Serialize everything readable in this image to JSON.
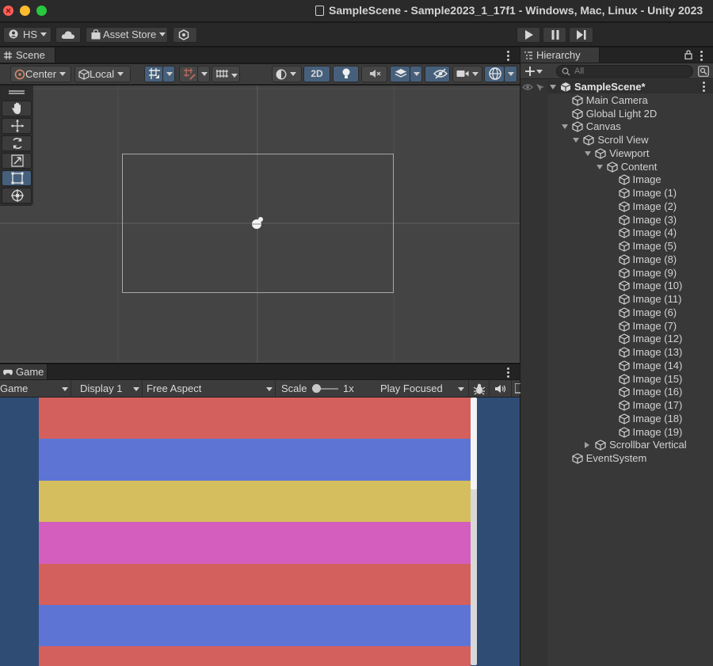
{
  "window": {
    "title": "SampleScene - Sample2023_1_17f1 - Windows, Mac, Linux - Unity 2023"
  },
  "toolbar": {
    "account_label": "HS",
    "asset_store_label": "Asset Store"
  },
  "scene_panel": {
    "tab_label": "Scene",
    "pivot_label": "Center",
    "space_label": "Local",
    "mode_2d_label": "2D"
  },
  "game_panel": {
    "tab_label": "Game",
    "view_select": "Game",
    "display_select": "Display 1",
    "aspect_select": "Free Aspect",
    "scale_label": "Scale",
    "scale_value": "1x",
    "play_mode_select": "Play Focused",
    "stripe_colors": [
      "#d4605e",
      "#5e74d4",
      "#d5be5e",
      "#d35ebd",
      "#d4605e",
      "#5e74d4",
      "#d4605e"
    ]
  },
  "hierarchy": {
    "tab_label": "Hierarchy",
    "search_placeholder": "All",
    "items": [
      {
        "label": "SampleScene*",
        "depth": 0,
        "fold": "down",
        "scene": true
      },
      {
        "label": "Main Camera",
        "depth": 1
      },
      {
        "label": "Global Light 2D",
        "depth": 1
      },
      {
        "label": "Canvas",
        "depth": 1,
        "fold": "down"
      },
      {
        "label": "Scroll View",
        "depth": 2,
        "fold": "down"
      },
      {
        "label": "Viewport",
        "depth": 3,
        "fold": "down"
      },
      {
        "label": "Content",
        "depth": 4,
        "fold": "down"
      },
      {
        "label": "Image",
        "depth": 5
      },
      {
        "label": "Image (1)",
        "depth": 5
      },
      {
        "label": "Image (2)",
        "depth": 5
      },
      {
        "label": "Image (3)",
        "depth": 5
      },
      {
        "label": "Image (4)",
        "depth": 5
      },
      {
        "label": "Image (5)",
        "depth": 5
      },
      {
        "label": "Image (8)",
        "depth": 5
      },
      {
        "label": "Image (9)",
        "depth": 5
      },
      {
        "label": "Image (10)",
        "depth": 5
      },
      {
        "label": "Image (11)",
        "depth": 5
      },
      {
        "label": "Image (6)",
        "depth": 5
      },
      {
        "label": "Image (7)",
        "depth": 5
      },
      {
        "label": "Image (12)",
        "depth": 5
      },
      {
        "label": "Image (13)",
        "depth": 5
      },
      {
        "label": "Image (14)",
        "depth": 5
      },
      {
        "label": "Image (15)",
        "depth": 5
      },
      {
        "label": "Image (16)",
        "depth": 5
      },
      {
        "label": "Image (17)",
        "depth": 5
      },
      {
        "label": "Image (18)",
        "depth": 5
      },
      {
        "label": "Image (19)",
        "depth": 5
      },
      {
        "label": "Scrollbar Vertical",
        "depth": 3,
        "fold": "right"
      },
      {
        "label": "EventSystem",
        "depth": 1
      }
    ]
  },
  "colors": {
    "accent": "#46607c",
    "game_background": "#2f4c75"
  }
}
